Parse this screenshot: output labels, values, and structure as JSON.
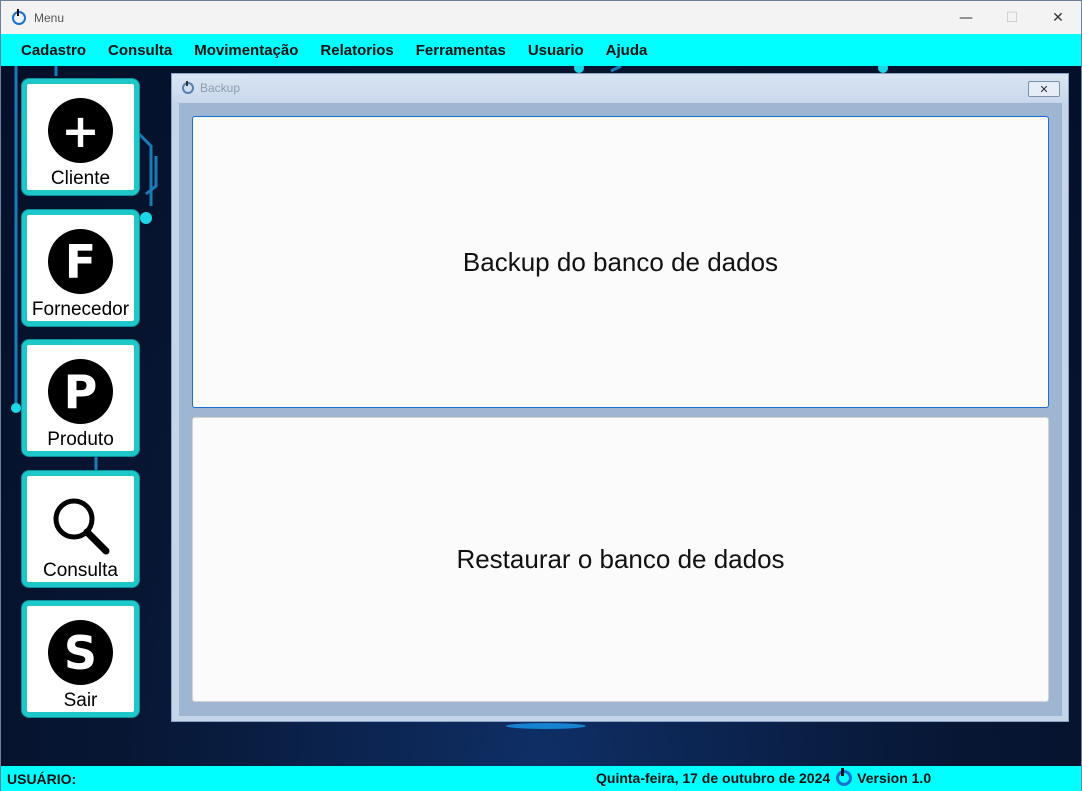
{
  "window": {
    "title": "Menu"
  },
  "menu": [
    "Cadastro",
    "Consulta",
    "Movimentação",
    "Relatorios",
    "Ferramentas",
    "Usuario",
    "Ajuda"
  ],
  "sidebar": [
    {
      "label": "Cliente",
      "glyph": "+",
      "icon": "plus-circle-icon"
    },
    {
      "label": "Fornecedor",
      "glyph": "F",
      "icon": "letter-f-circle-icon"
    },
    {
      "label": "Produto",
      "glyph": "P",
      "icon": "letter-p-circle-icon"
    },
    {
      "label": "Consulta",
      "icon": "search-icon"
    },
    {
      "label": "Sair",
      "glyph": "S",
      "icon": "letter-s-circle-icon"
    }
  ],
  "child": {
    "title": "Backup",
    "close": "✕",
    "backup_label": "Backup do banco de dados",
    "restore_label": "Restaurar o banco de dados"
  },
  "status": {
    "user_label": "USUÁRIO:",
    "date": "Quinta-feira, 17 de outubro de 2024",
    "version": "Version 1.0"
  },
  "colors": {
    "accent": "#00ffff",
    "button_border": "#1ec8c8",
    "background": "#071633"
  }
}
